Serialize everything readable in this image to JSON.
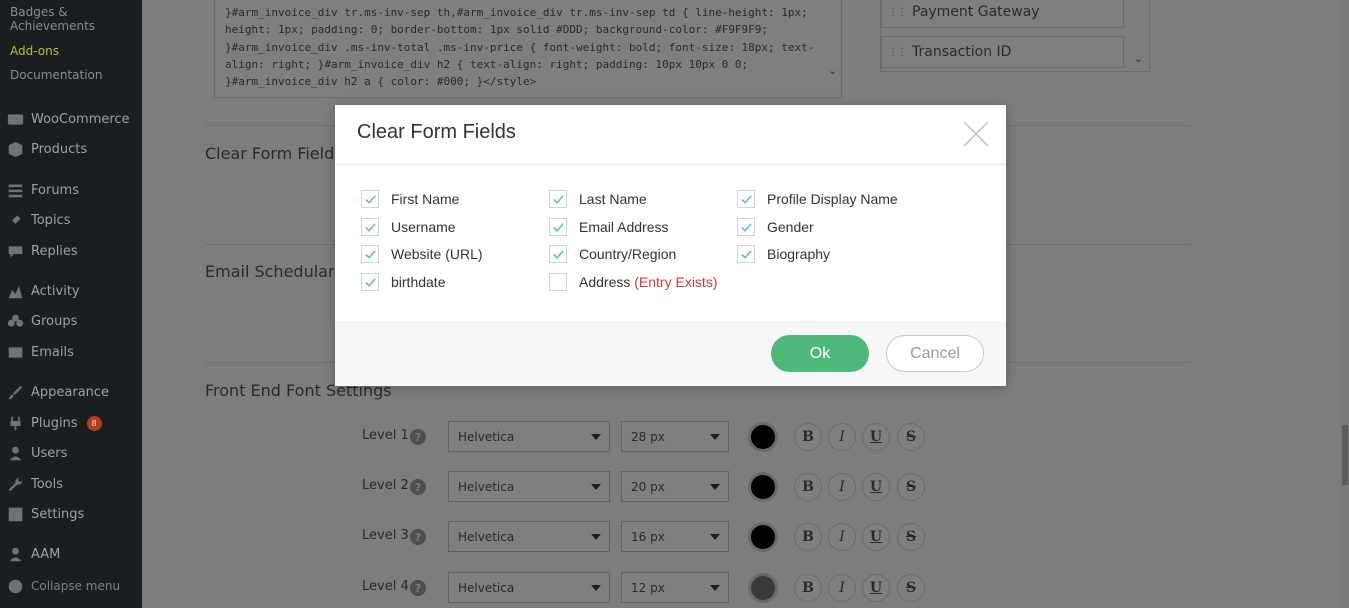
{
  "sidebar": {
    "top_items": [
      {
        "label": "Badges &",
        "active": false
      },
      {
        "label": "Achievements",
        "active": false
      },
      {
        "label": "Add-ons",
        "active": true
      },
      {
        "label": "Documentation",
        "active": false
      }
    ],
    "menu": [
      {
        "label": "WooCommerce",
        "icon": "woo-icon"
      },
      {
        "label": "Products",
        "icon": "box-icon"
      },
      {
        "label": "Forums",
        "icon": "forums-icon"
      },
      {
        "label": "Topics",
        "icon": "topics-icon"
      },
      {
        "label": "Replies",
        "icon": "replies-icon"
      },
      {
        "label": "Activity",
        "icon": "activity-icon"
      },
      {
        "label": "Groups",
        "icon": "groups-icon"
      },
      {
        "label": "Emails",
        "icon": "mail-icon"
      },
      {
        "label": "Appearance",
        "icon": "paintbrush-icon"
      },
      {
        "label": "Plugins",
        "icon": "plugin-icon",
        "badge": "8"
      },
      {
        "label": "Users",
        "icon": "users-icon"
      },
      {
        "label": "Tools",
        "icon": "wrench-icon"
      },
      {
        "label": "Settings",
        "icon": "settings-icon"
      },
      {
        "label": "AAM",
        "icon": "aam-icon"
      },
      {
        "label": "Collapse menu",
        "icon": "collapse-icon"
      }
    ]
  },
  "background": {
    "css_code": "}#arm_invoice_div tr.ms-inv-sep th,#arm_invoice_div tr.ms-inv-sep td { line-height: 1px; height: 1px; padding: 0; border-bottom: 1px solid #DDD; background-color: #F9F9F9; }#arm_invoice_div .ms-inv-total .ms-inv-price { font-weight: bold; font-size: 18px; text-align: right; }#arm_invoice_div h2 { text-align: right; padding: 10px 10px 0 0; }#arm_invoice_div h2 a { color: #000; }</style>",
    "field_list": [
      "Payment Gateway",
      "Transaction ID"
    ],
    "sections": {
      "clear_form_fields": "Clear Form Fields",
      "email_schedular": "Email Schedular S",
      "front_end_font": "Front End Font Settings"
    },
    "font_levels": [
      {
        "label": "Level 1",
        "font": "Helvetica",
        "size": "28 px",
        "color": "#000000"
      },
      {
        "label": "Level 2",
        "font": "Helvetica",
        "size": "20 px",
        "color": "#000000"
      },
      {
        "label": "Level 3",
        "font": "Helvetica",
        "size": "16 px",
        "color": "#000000"
      },
      {
        "label": "Level 4",
        "font": "Helvetica",
        "size": "12 px",
        "color": "#3a3a3a"
      }
    ],
    "format_buttons": [
      "B",
      "I",
      "U",
      "S"
    ]
  },
  "modal": {
    "title": "Clear Form Fields",
    "fields": [
      {
        "label": "First Name",
        "checked": true,
        "note": ""
      },
      {
        "label": "Last Name",
        "checked": true,
        "note": ""
      },
      {
        "label": "Profile Display Name",
        "checked": true,
        "note": ""
      },
      {
        "label": "Username",
        "checked": true,
        "note": ""
      },
      {
        "label": "Email Address",
        "checked": true,
        "note": ""
      },
      {
        "label": "Gender",
        "checked": true,
        "note": ""
      },
      {
        "label": "Website (URL)",
        "checked": true,
        "note": ""
      },
      {
        "label": "Country/Region",
        "checked": true,
        "note": ""
      },
      {
        "label": "Biography",
        "checked": true,
        "note": ""
      },
      {
        "label": "birthdate",
        "checked": true,
        "note": ""
      },
      {
        "label": "Address",
        "checked": false,
        "note": "(Entry Exists)"
      }
    ],
    "ok_label": "Ok",
    "cancel_label": "Cancel"
  },
  "colors": {
    "ok_green": "#4eb97a",
    "check_teal": "#5fc7c7",
    "entry_exists_red": "#d03939"
  }
}
